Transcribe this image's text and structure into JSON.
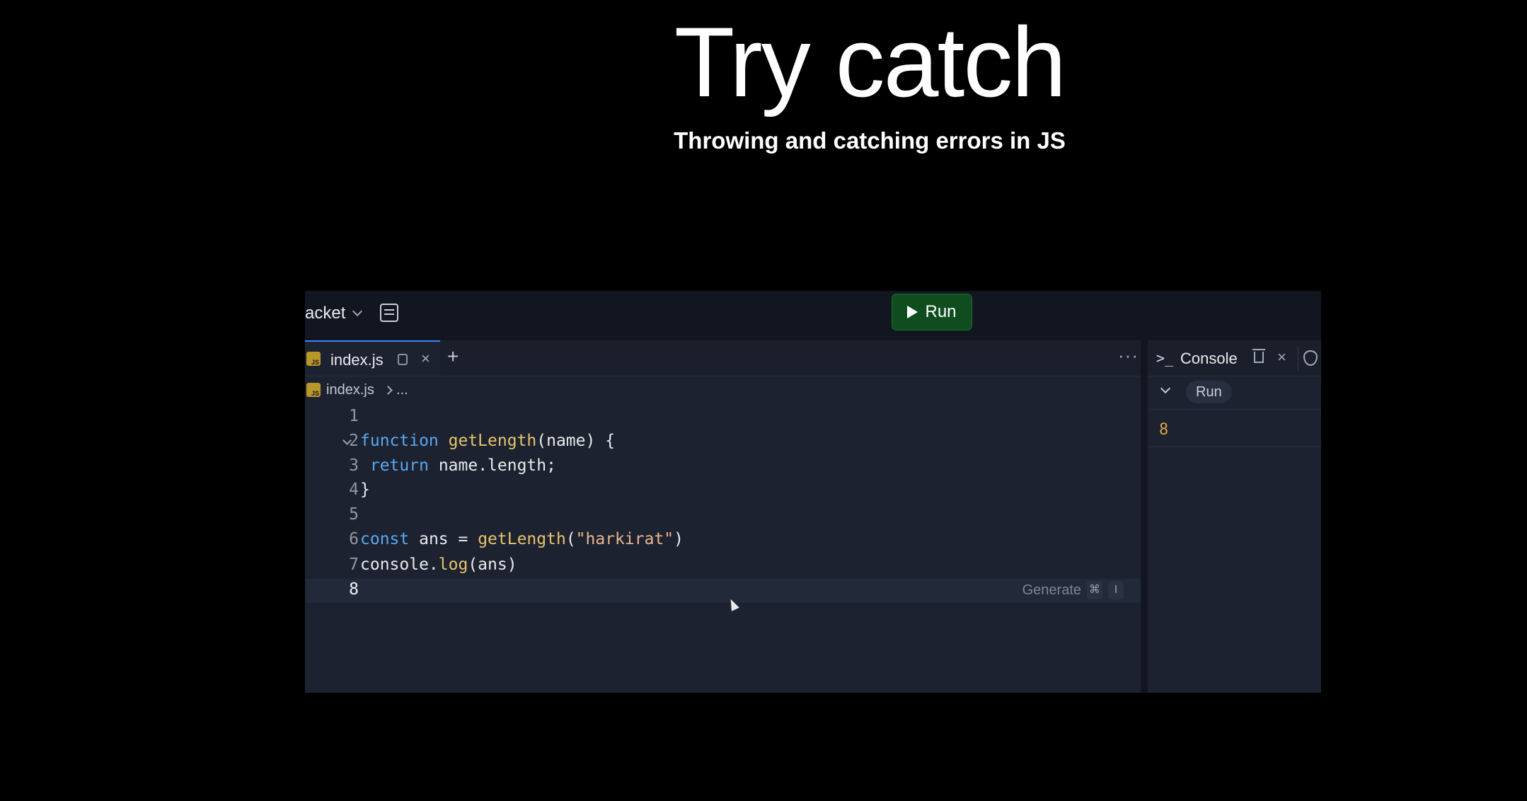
{
  "slide": {
    "title": "Try catch",
    "subtitle": "Throwing and catching errors in JS"
  },
  "topbar": {
    "project_name": "acket",
    "run_label": "Run",
    "run_color": "#0f4d1f"
  },
  "editor": {
    "tab_label": "index.js",
    "tab_close": "×",
    "tab_add": "+",
    "more": "···",
    "breadcrumb_file": "index.js",
    "breadcrumb_more": "...",
    "js_badge": "JS",
    "generate_label": "Generate",
    "generate_keys": [
      "⌘",
      "I"
    ],
    "line_numbers": [
      "1",
      "2",
      "3",
      "4",
      "5",
      "6",
      "7",
      "8"
    ],
    "code": {
      "line2": {
        "kw": "function",
        "fn": "getLength",
        "rest": "(name) {"
      },
      "line3": {
        "kw": "return",
        "rest": "name.length;"
      },
      "line4": "}",
      "line6": {
        "kw": "const",
        "mid": " ans = ",
        "fn": "getLength",
        "p1": "(",
        "str": "\"harkirat\"",
        "p2": ")"
      },
      "line7": {
        "obj": "console.",
        "fn": "log",
        "rest": "(ans)"
      }
    }
  },
  "console": {
    "title": "Console",
    "prompt_icon": ">_",
    "close": "×",
    "run_label": "Run",
    "output": "8"
  }
}
